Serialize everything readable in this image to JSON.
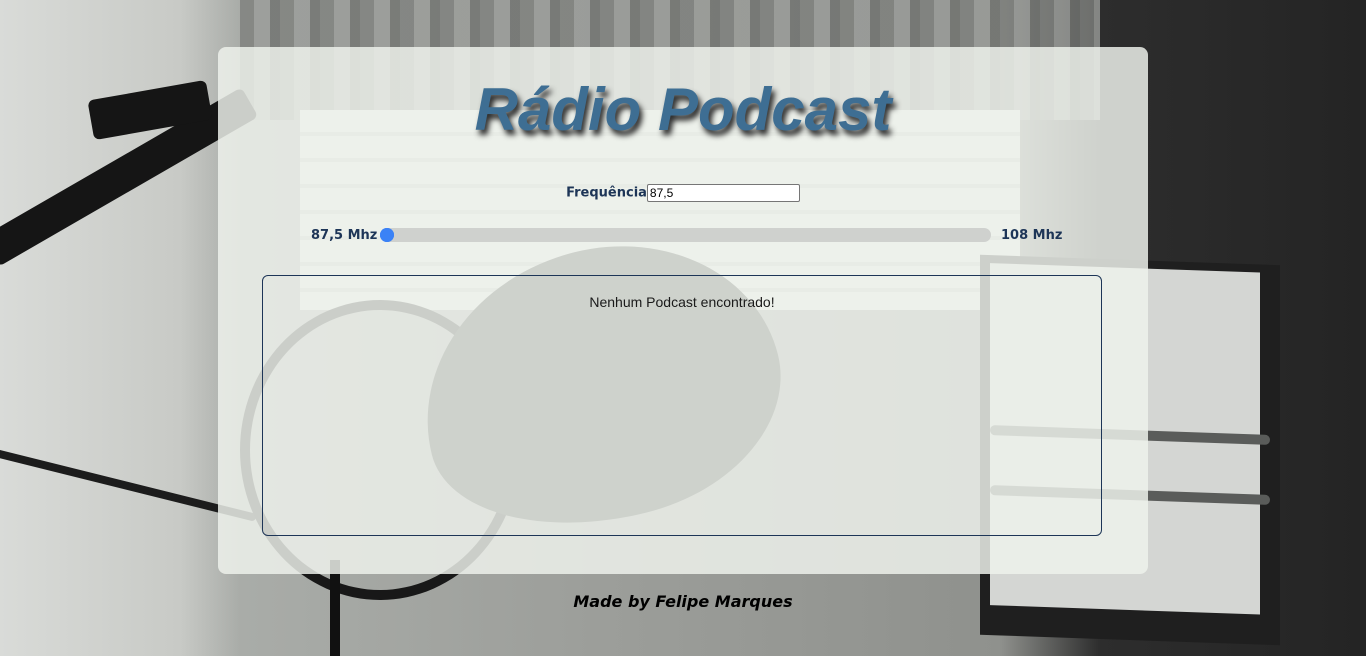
{
  "header": {
    "title": "Rádio Podcast"
  },
  "frequency": {
    "label": "Frequência",
    "value": "87,5"
  },
  "slider": {
    "min_label": "87,5 Mhz",
    "max_label": "108 Mhz",
    "min": 87.5,
    "max": 108,
    "value": 87.5
  },
  "results": {
    "empty_message": "Nenhum Podcast encontrado!"
  },
  "footer": {
    "credit": "Made by Felipe Marques"
  },
  "colors": {
    "title": "#3e6e93",
    "label": "#1d3557",
    "accent": "#3b82f6",
    "card": "#eef2ec"
  }
}
